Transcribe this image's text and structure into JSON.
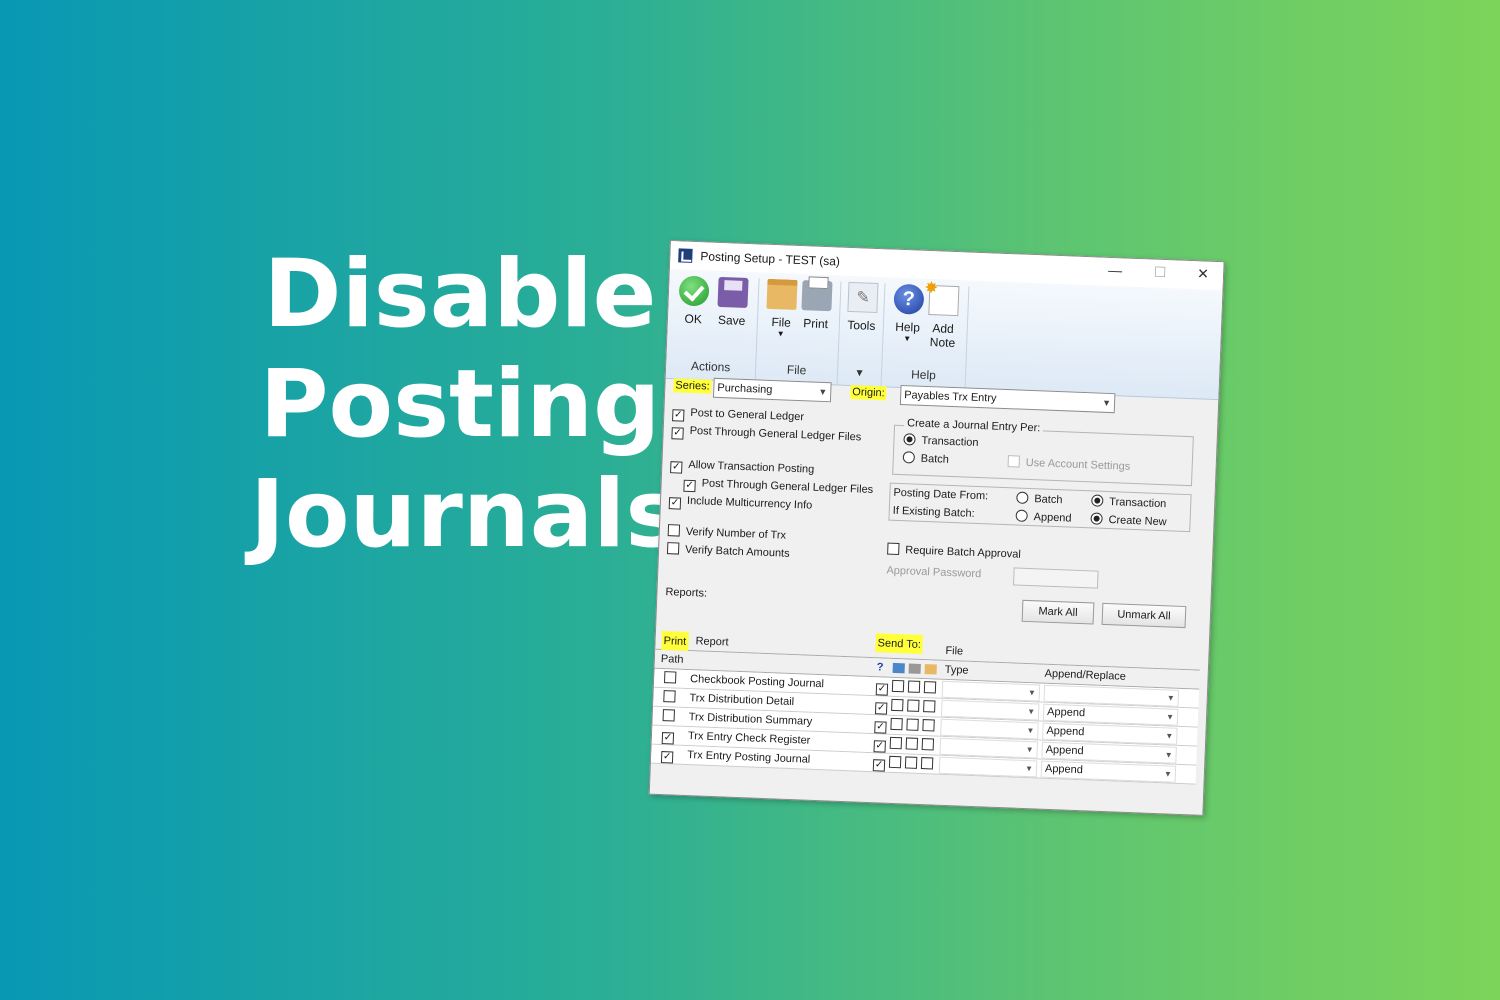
{
  "headline": {
    "line1": "Disable",
    "line2": "Posting",
    "line3": "Journals"
  },
  "window": {
    "title": "Posting Setup  -  TEST (sa)",
    "minimize": "—",
    "maximize": "☐",
    "close": "✕"
  },
  "ribbon": {
    "actions": {
      "label": "Actions",
      "ok": "OK",
      "save": "Save"
    },
    "file": {
      "label": "File",
      "file": "File",
      "print": "Print"
    },
    "tools": {
      "tools": "Tools",
      "more": "▾"
    },
    "help": {
      "label": "Help",
      "help": "Help",
      "add_note_1": "Add",
      "add_note_2": "Note"
    }
  },
  "form": {
    "series_label": "Series:",
    "series_value": "Purchasing",
    "origin_label": "Origin:",
    "origin_value": "Payables Trx Entry",
    "post_gl": "Post to General Ledger",
    "post_through_gl": "Post Through General Ledger Files",
    "allow_trx_posting": "Allow Transaction Posting",
    "post_through_gl_2": "Post Through General Ledger Files",
    "include_multicurrency": "Include Multicurrency Info",
    "verify_number": "Verify Number of Trx",
    "verify_batch": "Verify Batch Amounts",
    "journal_entry_per": "Create a Journal Entry Per:",
    "transaction": "Transaction",
    "batch": "Batch",
    "use_account_settings": "Use Account Settings",
    "posting_date_from": "Posting Date From:",
    "pd_batch": "Batch",
    "pd_transaction": "Transaction",
    "if_existing_batch": "If Existing Batch:",
    "eb_append": "Append",
    "eb_create_new": "Create New",
    "require_batch_approval": "Require Batch Approval",
    "approval_password": "Approval Password"
  },
  "reports": {
    "label": "Reports:",
    "mark_all": "Mark All",
    "unmark_all": "Unmark All",
    "col_print": "Print",
    "col_report": "Report",
    "col_send_to": "Send To:",
    "col_file": "File",
    "col_path": "Path",
    "col_help": "?",
    "col_type": "Type",
    "col_append_replace": "Append/Replace",
    "rows": [
      {
        "print": false,
        "name": "Checkbook Posting Journal",
        "append": ""
      },
      {
        "print": false,
        "name": "Trx Distribution Detail",
        "append": "Append"
      },
      {
        "print": false,
        "name": "Trx Distribution Summary",
        "append": "Append"
      },
      {
        "print": true,
        "name": "Trx Entry Check Register",
        "append": "Append"
      },
      {
        "print": true,
        "name": "Trx Entry Posting Journal",
        "append": "Append"
      }
    ]
  }
}
